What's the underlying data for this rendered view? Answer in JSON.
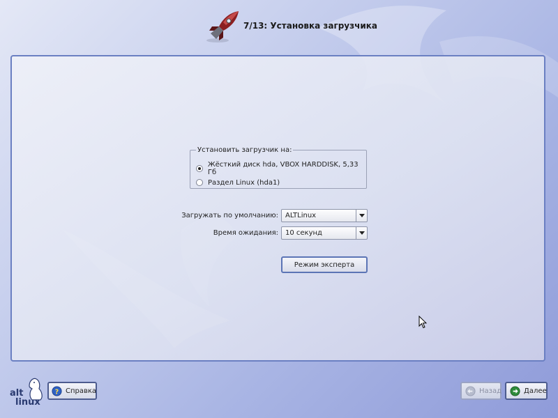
{
  "header": {
    "step_title": "7/13: Установка загрузчика",
    "icon": "rocket-icon"
  },
  "bootloader_group": {
    "legend": "Установить загрузчик на:",
    "options": [
      {
        "label": "Жёсткий диск hda, VBOX HARDDISK, 5,33 Гб",
        "selected": true
      },
      {
        "label": "Раздел Linux (hda1)",
        "selected": false
      }
    ]
  },
  "default_boot": {
    "label": "Загружать по умолчанию:",
    "value": "ALTLinux"
  },
  "timeout": {
    "label": "Время ожидания:",
    "value": "10 секунд"
  },
  "expert_button": {
    "label": "Режим эксперта"
  },
  "footer": {
    "logo": {
      "line1": "alt",
      "line2": "linux"
    },
    "help_button": {
      "label": "Справка",
      "icon": "help-icon"
    },
    "back_button": {
      "label": "Назад",
      "icon": "back-arrow-icon",
      "enabled": false
    },
    "next_button": {
      "label": "Далее",
      "icon": "forward-arrow-icon",
      "enabled": true
    }
  },
  "colors": {
    "panel_border": "#6a7fc2",
    "accent_green": "#2e8b3a",
    "background_light": "#e4e8f6",
    "background_dark": "#8f9bd9"
  }
}
